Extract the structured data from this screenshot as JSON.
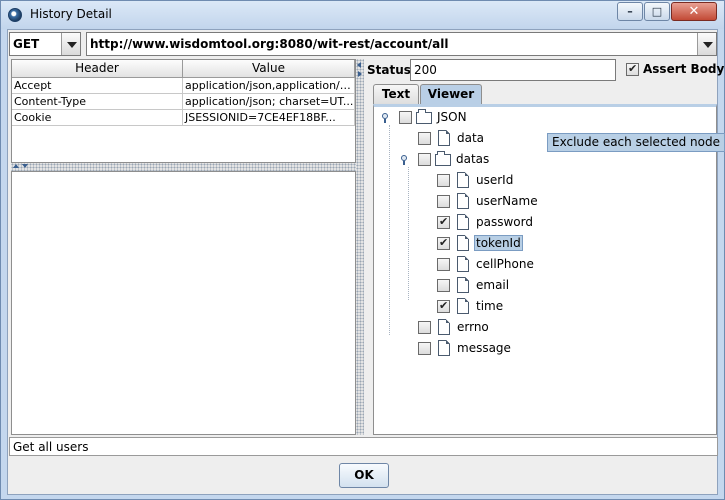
{
  "window": {
    "title": "History Detail",
    "controls": {
      "minimize": "–",
      "maximize": "□",
      "close": "✕"
    }
  },
  "request": {
    "method": "GET",
    "url": "http://www.wisdomtool.org:8080/wit-rest/account/all"
  },
  "headers_table": {
    "columns": [
      "Header",
      "Value"
    ],
    "rows": [
      {
        "header": "Accept",
        "value": "application/json,application/x..."
      },
      {
        "header": "Content-Type",
        "value": "application/json; charset=UT..."
      },
      {
        "header": "Cookie",
        "value": "JSESSIONID=7CE4EF18BF..."
      }
    ]
  },
  "response": {
    "status_label": "Status:",
    "status_value": "200",
    "assert_body_label": "Assert Body",
    "assert_body_checked": true
  },
  "tabs": [
    {
      "label": "Text",
      "selected": false
    },
    {
      "label": "Viewer",
      "selected": true
    }
  ],
  "tree": {
    "tooltip": "Exclude each selected node",
    "nodes": [
      {
        "label": "JSON",
        "type": "object",
        "checked": false
      },
      {
        "label": "data",
        "type": "field",
        "checked": false
      },
      {
        "label": "datas",
        "type": "object",
        "checked": false
      },
      {
        "label": "userId",
        "type": "field",
        "checked": false
      },
      {
        "label": "userName",
        "type": "field",
        "checked": false
      },
      {
        "label": "password",
        "type": "field",
        "checked": true
      },
      {
        "label": "tokenId",
        "type": "field",
        "checked": true,
        "selected": true
      },
      {
        "label": "cellPhone",
        "type": "field",
        "checked": false
      },
      {
        "label": "email",
        "type": "field",
        "checked": false
      },
      {
        "label": "time",
        "type": "field",
        "checked": true
      },
      {
        "label": "errno",
        "type": "field",
        "checked": false
      },
      {
        "label": "message",
        "type": "field",
        "checked": false
      }
    ]
  },
  "description": "Get all users",
  "ok_label": "OK",
  "colors": {
    "title_bar": "#c4d7ee",
    "selection": "#b8cfe5",
    "close_button": "#c24a36"
  }
}
